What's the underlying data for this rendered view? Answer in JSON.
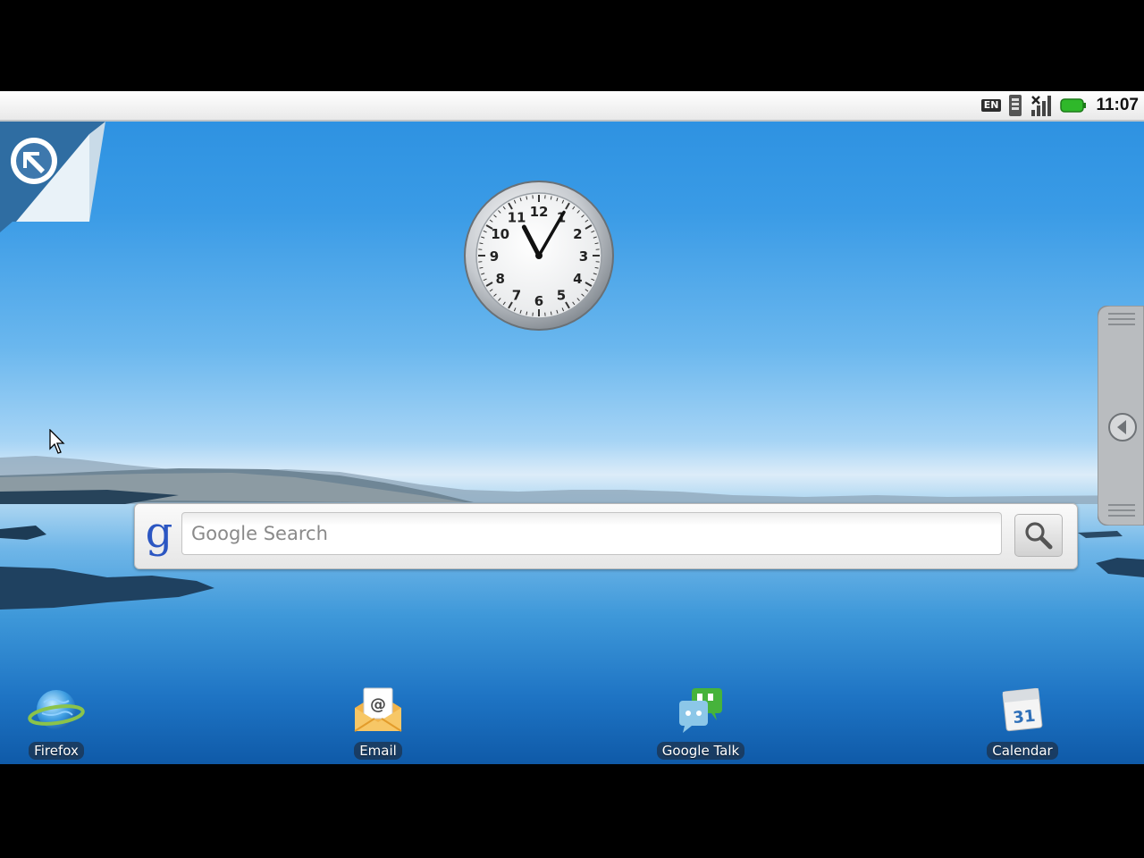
{
  "status_bar": {
    "language": "EN",
    "time": "11:07",
    "battery_color": "#2fb82a"
  },
  "clock": {
    "hour": 11,
    "minute": 5,
    "numerals": [
      "12",
      "1",
      "2",
      "3",
      "4",
      "5",
      "6",
      "7",
      "8",
      "9",
      "10",
      "11"
    ]
  },
  "search": {
    "logo": "g",
    "placeholder": "Google Search"
  },
  "dock": {
    "items": [
      {
        "label": "Firefox",
        "icon": "globe-icon"
      },
      {
        "label": "Email",
        "icon": "envelope-icon"
      },
      {
        "label": "Google Talk",
        "icon": "chat-bubbles-icon"
      },
      {
        "label": "Calendar",
        "icon": "calendar-icon",
        "day": "31"
      }
    ]
  },
  "colors": {
    "sky_top": "#2a8fe0",
    "water_bottom": "#0f5aa8",
    "google_blue": "#2b56c2"
  }
}
